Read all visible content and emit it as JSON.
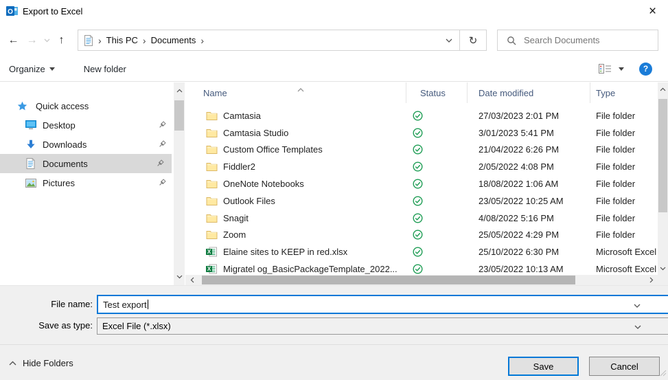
{
  "window": {
    "title": "Export to Excel"
  },
  "nav": {
    "breadcrumb": [
      "This PC",
      "Documents"
    ],
    "search_placeholder": "Search Documents"
  },
  "toolbar": {
    "organize_label": "Organize",
    "new_folder_label": "New folder"
  },
  "sidebar": {
    "items": [
      {
        "id": "quick-access",
        "label": "Quick access",
        "icon": "star",
        "root": true,
        "pinned": false,
        "selected": false
      },
      {
        "id": "desktop",
        "label": "Desktop",
        "icon": "desktop",
        "pinned": true,
        "selected": false
      },
      {
        "id": "downloads",
        "label": "Downloads",
        "icon": "downloads",
        "pinned": true,
        "selected": false
      },
      {
        "id": "documents",
        "label": "Documents",
        "icon": "document",
        "pinned": true,
        "selected": true
      },
      {
        "id": "pictures",
        "label": "Pictures",
        "icon": "pictures",
        "pinned": true,
        "selected": false
      }
    ]
  },
  "file_list": {
    "columns": [
      "Name",
      "Status",
      "Date modified",
      "Type"
    ],
    "sort_column": "Name",
    "rows": [
      {
        "name": "Camtasia",
        "icon": "folder",
        "status": "synced",
        "date_modified": "27/03/2023 2:01 PM",
        "type": "File folder"
      },
      {
        "name": "Camtasia Studio",
        "icon": "folder",
        "status": "synced",
        "date_modified": "3/01/2023 5:41 PM",
        "type": "File folder"
      },
      {
        "name": "Custom Office Templates",
        "icon": "folder",
        "status": "synced",
        "date_modified": "21/04/2022 6:26 PM",
        "type": "File folder"
      },
      {
        "name": "Fiddler2",
        "icon": "folder",
        "status": "synced",
        "date_modified": "2/05/2022 4:08 PM",
        "type": "File folder"
      },
      {
        "name": "OneNote Notebooks",
        "icon": "folder",
        "status": "synced",
        "date_modified": "18/08/2022 1:06 AM",
        "type": "File folder"
      },
      {
        "name": "Outlook Files",
        "icon": "folder",
        "status": "synced",
        "date_modified": "23/05/2022 10:25 AM",
        "type": "File folder"
      },
      {
        "name": "Snagit",
        "icon": "folder",
        "status": "synced",
        "date_modified": "4/08/2022 5:16 PM",
        "type": "File folder"
      },
      {
        "name": "Zoom",
        "icon": "folder",
        "status": "synced",
        "date_modified": "25/05/2022 4:29 PM",
        "type": "File folder"
      },
      {
        "name": "Elaine sites to KEEP in red.xlsx",
        "icon": "excel",
        "status": "synced",
        "date_modified": "25/10/2022 6:30 PM",
        "type": "Microsoft Excel"
      },
      {
        "name": "Migratel og_BasicPackageTemplate_2022...",
        "icon": "excel",
        "status": "synced",
        "date_modified": "23/05/2022 10:13 AM",
        "type": "Microsoft Excel"
      }
    ]
  },
  "footer": {
    "file_name_label": "File name:",
    "file_name_value": "Test export",
    "save_as_type_label": "Save as type:",
    "save_as_type_value": "Excel File (*.xlsx)",
    "hide_folders_label": "Hide Folders",
    "save_label": "Save",
    "cancel_label": "Cancel"
  },
  "colors": {
    "accent": "#0078d7",
    "selection_gray": "#d9d9d9",
    "folder_yellow": "#ffe9a2",
    "excel_green": "#107c41",
    "status_green": "#1f9d55",
    "help_blue": "#1a7cd8"
  }
}
